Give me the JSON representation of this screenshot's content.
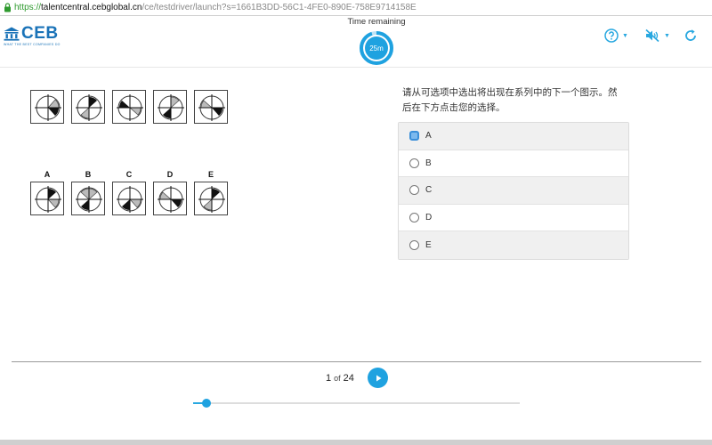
{
  "browser": {
    "url_scheme": "https://",
    "url_host": "talentcentral.cebglobal.cn",
    "url_path": "/ce/testdriver/launch?s=1661B3DD-56C1-4FE0-890E-758E9714158E"
  },
  "header": {
    "logo_text": "CEB",
    "logo_tagline": "WHAT THE BEST COMPANIES DO",
    "timer_label": "Time remaining",
    "timer_value": "25m",
    "timer_fraction_remaining": 0.95,
    "icons": [
      "help-icon",
      "mute-audio-icon",
      "refresh-icon"
    ]
  },
  "puzzle": {
    "series_count": 5,
    "option_letters": [
      "A",
      "B",
      "C",
      "D",
      "E"
    ]
  },
  "question": {
    "text": "请从可选项中选出将出现在系列中的下一个图示。然后在下方点击您的选择。"
  },
  "answers": [
    {
      "letter": "A",
      "focused": true
    },
    {
      "letter": "B",
      "focused": false
    },
    {
      "letter": "C",
      "focused": false
    },
    {
      "letter": "D",
      "focused": false
    },
    {
      "letter": "E",
      "focused": false
    }
  ],
  "pager": {
    "current": "1",
    "of": "of",
    "total": "24",
    "progress_fraction": 0.04
  },
  "colors": {
    "accent": "#1fa2e0",
    "logo_blue": "#1a73b8",
    "url_green": "#2e9a2e"
  }
}
